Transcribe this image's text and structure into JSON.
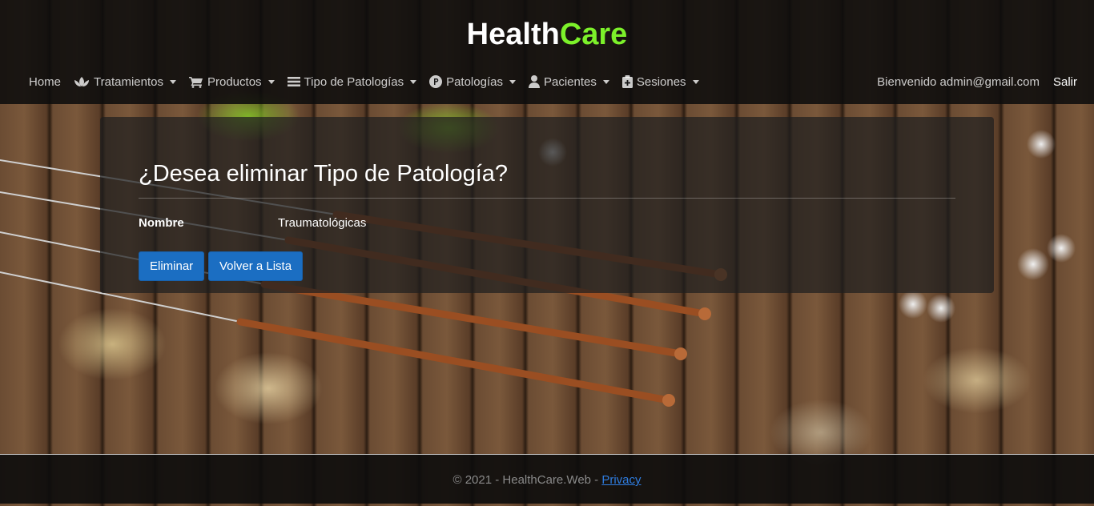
{
  "brand": {
    "part1": "Health",
    "part2": "Care",
    "color_part2": "#7cf12a"
  },
  "nav": {
    "home": "Home",
    "tratamientos": "Tratamientos",
    "productos": "Productos",
    "tipo_patologias": "Tipo de Patologías",
    "patologias": "Patologías",
    "pacientes": "Pacientes",
    "sesiones": "Sesiones",
    "welcome": "Bienvenido admin@gmail.com",
    "logout": "Salir"
  },
  "icons": {
    "tratamientos": "lotus-icon",
    "productos": "cart-icon",
    "tipo_patologias": "list-icon",
    "patologias": "p-circle-icon",
    "pacientes": "user-icon",
    "sesiones": "clipboard-plus-icon"
  },
  "card": {
    "title": "¿Desea eliminar Tipo de Patología?",
    "field_label": "Nombre",
    "field_value": "Traumatológicas",
    "delete_label": "Eliminar",
    "back_label": "Volver a Lista"
  },
  "footer": {
    "text": "© 2021 - HealthCare.Web - ",
    "privacy": "Privacy"
  },
  "colors": {
    "button": "#1b6ec2",
    "navbar": "#0c0c0c",
    "link": "#2f7de1"
  }
}
